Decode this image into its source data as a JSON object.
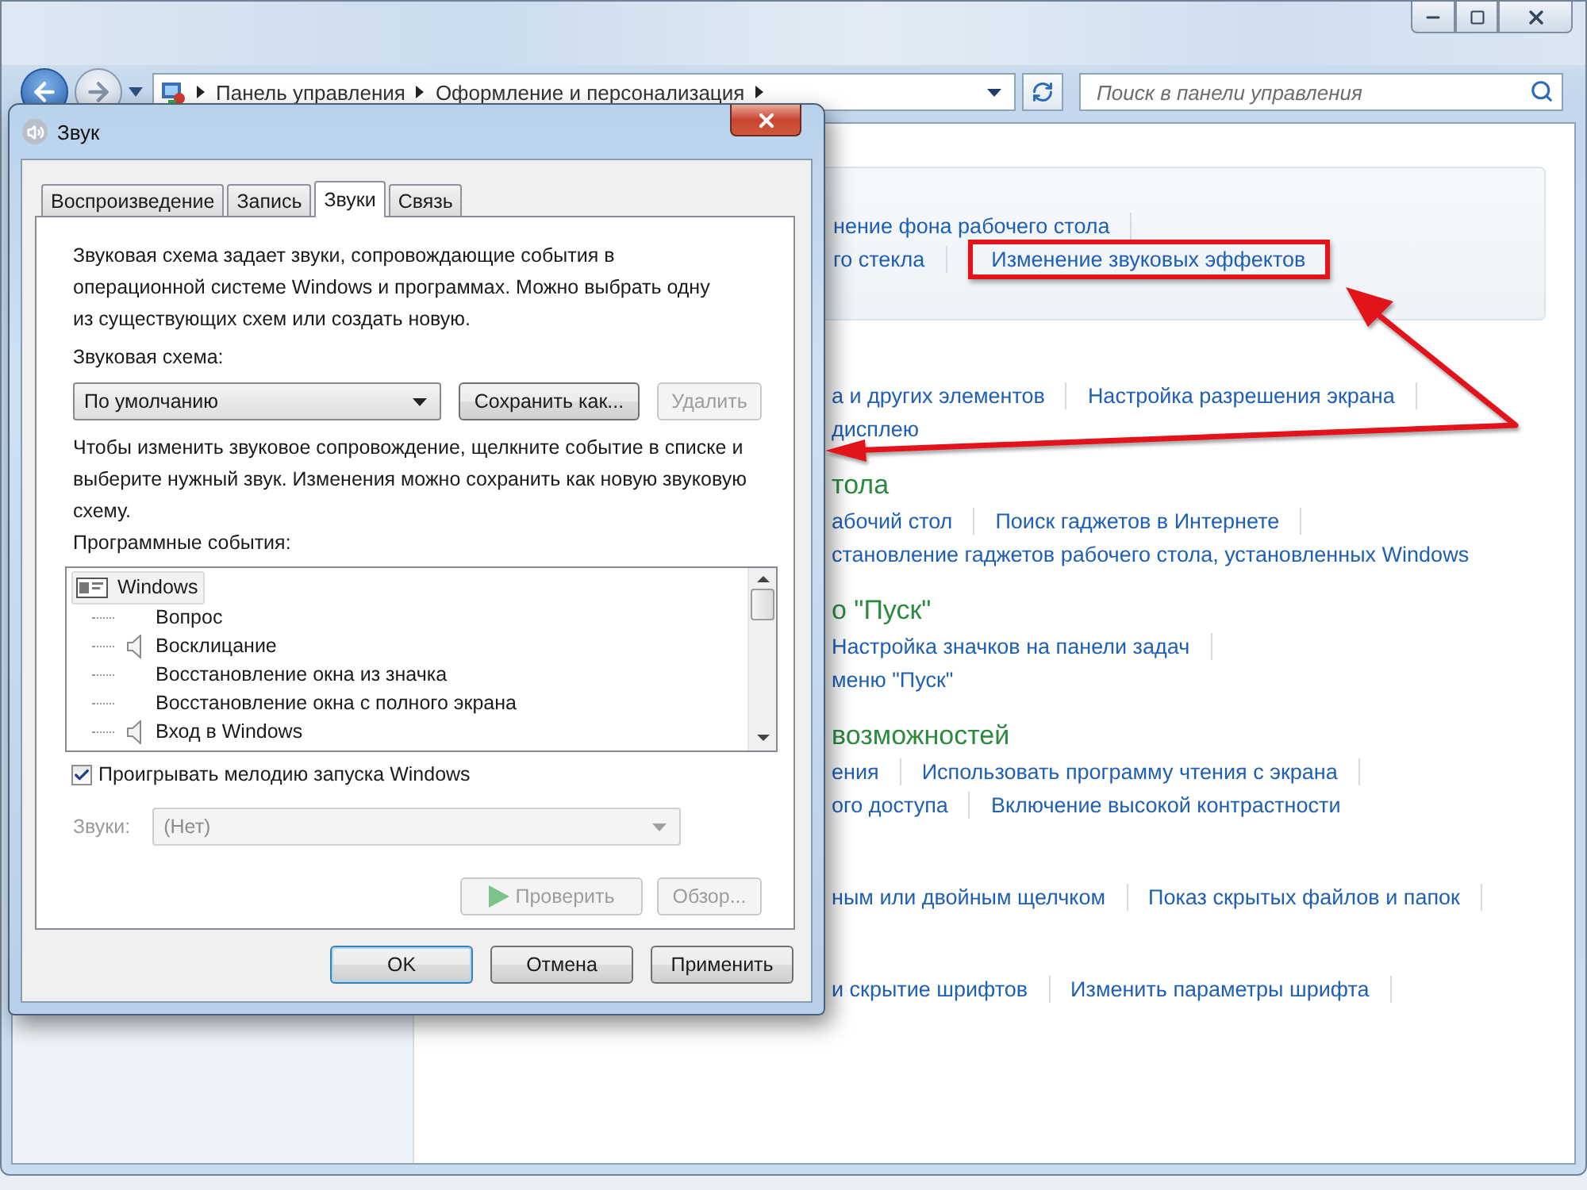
{
  "control_panel": {
    "address_bar": {
      "breadcrumb": [
        "Панель управления",
        "Оформление и персонализация"
      ]
    },
    "search": {
      "placeholder": "Поиск в панели управления"
    },
    "sections": [
      {
        "boxed": true,
        "rows": [
          [
            {
              "text": "нение фона рабочего стола",
              "marked": false
            }
          ],
          [
            {
              "text": "го стекла",
              "marked": false
            },
            {
              "text": "Изменение звуковых эффектов",
              "marked": true
            }
          ]
        ]
      },
      {
        "rows": [
          [
            {
              "text": "а и других элементов",
              "marked": false
            },
            {
              "text": "Настройка разрешения экрана",
              "marked": false
            }
          ],
          [
            {
              "text": "дисплею",
              "marked": false
            }
          ]
        ]
      },
      {
        "heading": "тола",
        "rows": [
          [
            {
              "text": "абочий стол",
              "marked": false
            },
            {
              "text": "Поиск гаджетов в Интернете",
              "marked": false
            }
          ],
          [
            {
              "text": "становление гаджетов рабочего стола, установленных Windows",
              "marked": false
            }
          ]
        ]
      },
      {
        "heading": "о \"Пуск\"",
        "rows": [
          [
            {
              "text": "Настройка значков на панели задач",
              "marked": false
            }
          ],
          [
            {
              "text": "меню \"Пуск\"",
              "marked": false
            }
          ]
        ]
      },
      {
        "heading": "возможностей",
        "rows": [
          [
            {
              "text": "ения",
              "marked": false
            },
            {
              "text": "Использовать программу чтения с экрана",
              "marked": false
            }
          ],
          [
            {
              "text": "ого доступа",
              "marked": false
            },
            {
              "text": "Включение высокой контрастности",
              "marked": false
            }
          ]
        ]
      },
      {
        "rows": [
          [
            {
              "text": "ным или двойным щелчком",
              "marked": false
            },
            {
              "text": "Показ скрытых файлов и папок",
              "marked": false
            }
          ]
        ]
      },
      {
        "rows": [
          [
            {
              "text": "и скрытие шрифтов",
              "marked": false
            },
            {
              "text": "Изменить параметры шрифта",
              "marked": false
            }
          ]
        ]
      }
    ]
  },
  "dialog": {
    "title": "Звук",
    "tabs": [
      {
        "label": "Воспроизведение",
        "selected": false
      },
      {
        "label": "Запись",
        "selected": false
      },
      {
        "label": "Звуки",
        "selected": true
      },
      {
        "label": "Связь",
        "selected": false
      }
    ],
    "intro": "Звуковая схема задает звуки, сопровождающие события в операционной системе Windows и программах. Можно выбрать одну из существующих схем или создать новую.",
    "scheme_label": "Звуковая схема:",
    "scheme": {
      "value": "По умолчанию"
    },
    "scheme_buttons": [
      {
        "label": "Сохранить как...",
        "disabled": false
      },
      {
        "label": "Удалить",
        "disabled": true
      }
    ],
    "hint": "Чтобы изменить звуковое сопровождение, щелкните событие в списке и выберите нужный звук. Изменения можно сохранить как новую звуковую схему.",
    "events_label": "Программные события:",
    "events": [
      {
        "label": "Windows",
        "selected": true,
        "children": [
          {
            "label": "Вопрос",
            "sound": false
          },
          {
            "label": "Восклицание",
            "sound": true
          },
          {
            "label": "Восстановление окна из значка",
            "sound": false
          },
          {
            "label": "Восстановление окна с полного экрана",
            "sound": false
          },
          {
            "label": "Вход в Windows",
            "sound": true
          }
        ]
      }
    ],
    "startup_checkbox": {
      "label": "Проигрывать мелодию запуска Windows",
      "checked": true
    },
    "sounds_field": {
      "label": "Звуки:",
      "value": "(Нет)",
      "disabled": true
    },
    "preview_buttons": [
      {
        "label": "Проверить",
        "kind": "play",
        "disabled": true
      },
      {
        "label": "Обзор...",
        "kind": "plain",
        "disabled": true
      }
    ],
    "footer_buttons": [
      {
        "label": "OK",
        "default": true
      },
      {
        "label": "Отмена",
        "default": false
      },
      {
        "label": "Применить",
        "default": false
      }
    ]
  }
}
